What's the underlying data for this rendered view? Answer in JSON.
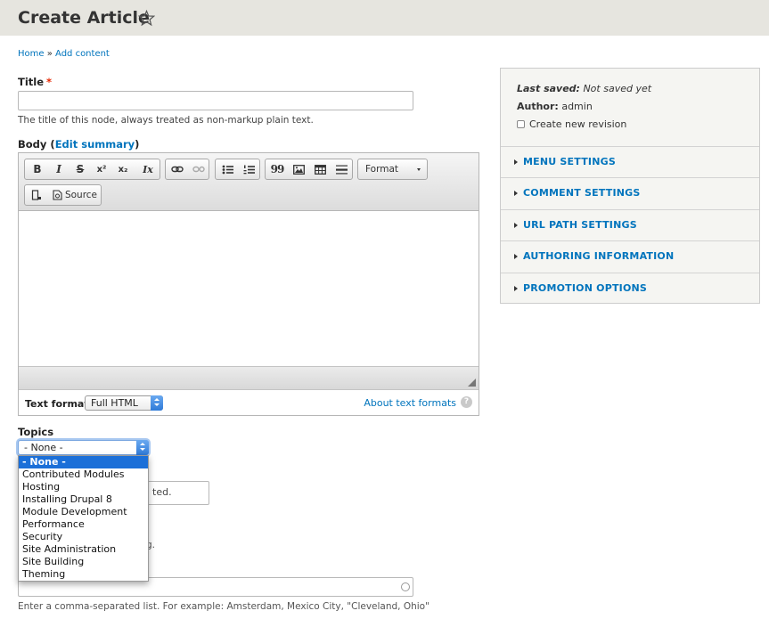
{
  "header": {
    "title": "Create Article",
    "star_icon": "star-outline-icon"
  },
  "breadcrumb": {
    "home": "Home",
    "separator": "»",
    "current": "Add content"
  },
  "title_field": {
    "label": "Title",
    "required_marker": "*",
    "value": "",
    "description": "The title of this node, always treated as non-markup plain text."
  },
  "body_field": {
    "label": "Body",
    "open_paren": "(",
    "edit_summary": "Edit summary",
    "close_paren": ")",
    "toolbar": {
      "bold": "B",
      "italic": "I",
      "strike": "S",
      "superscript": "x²",
      "subscript": "x₂",
      "remove_format": "Ix",
      "quote": "99",
      "format_label": "Format",
      "source_label": "Source"
    },
    "text_format_label": "Text format",
    "text_format_value": "Full HTML",
    "about_formats": "About text formats",
    "help": "?"
  },
  "topics": {
    "label": "Topics",
    "selected": "- None -",
    "options": [
      "- None -",
      "Contributed Modules",
      "Hosting",
      "Installing Drupal 8",
      "Module Development",
      "Performance",
      "Security",
      "Site Administration",
      "Site Building",
      "Theming"
    ]
  },
  "hidden_fragments": {
    "image_hint": "ted.",
    "alt_hint": "g."
  },
  "tags_field": {
    "description": "Enter a comma-separated list. For example: Amsterdam, Mexico City, \"Cleveland, Ohio\""
  },
  "sidebar": {
    "last_saved_label": "Last saved:",
    "last_saved_value": "Not saved yet",
    "author_label": "Author:",
    "author_value": "admin",
    "revision_label": "Create new revision",
    "sections": [
      "MENU SETTINGS",
      "COMMENT SETTINGS",
      "URL PATH SETTINGS",
      "AUTHORING INFORMATION",
      "PROMOTION OPTIONS"
    ]
  },
  "colors": {
    "link": "#0074bd",
    "header_bg": "#e6e5df",
    "required": "#e62600",
    "selected_option": "#1b6fd8"
  }
}
